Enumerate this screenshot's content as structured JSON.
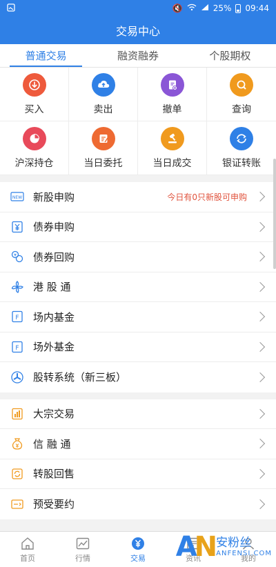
{
  "status_bar": {
    "left_icon": "image-icon",
    "battery": "25%",
    "time": "09:44"
  },
  "title": "交易中心",
  "tabs": [
    {
      "label": "普通交易",
      "active": true
    },
    {
      "label": "融资融券",
      "active": false
    },
    {
      "label": "个股期权",
      "active": false
    }
  ],
  "grid": [
    {
      "label": "买入",
      "icon": "download-icon",
      "color": "#ee5a3c"
    },
    {
      "label": "卖出",
      "icon": "upload-icon",
      "color": "#2f80e6"
    },
    {
      "label": "撤单",
      "icon": "cancel-doc-icon",
      "color": "#8a56d6"
    },
    {
      "label": "查询",
      "icon": "search-icon",
      "color": "#f09a1e"
    },
    {
      "label": "沪深持仓",
      "icon": "pie-chart-icon",
      "color": "#e84a5a"
    },
    {
      "label": "当日委托",
      "icon": "order-doc-icon",
      "color": "#ee6a32"
    },
    {
      "label": "当日成交",
      "icon": "gavel-icon",
      "color": "#f09a1e"
    },
    {
      "label": "银证转账",
      "icon": "transfer-icon",
      "color": "#2f80e6"
    }
  ],
  "list1": [
    {
      "label": "新股申购",
      "icon": "new-icon",
      "note": "今日有0只新股可申购"
    },
    {
      "label": "债券申购",
      "icon": "bond-icon",
      "note": ""
    },
    {
      "label": "债券回购",
      "icon": "repo-icon",
      "note": ""
    },
    {
      "label": "港 股 通",
      "icon": "bauhinia-icon",
      "note": ""
    },
    {
      "label": "场内基金",
      "icon": "fund-icon",
      "note": ""
    },
    {
      "label": "场外基金",
      "icon": "fund-icon",
      "note": ""
    },
    {
      "label": "股转系统（新三板）",
      "icon": "share-transfer-icon",
      "note": ""
    }
  ],
  "list2": [
    {
      "label": "大宗交易",
      "icon": "block-trade-icon",
      "note": ""
    },
    {
      "label": "信 融 通",
      "icon": "money-bag-icon",
      "note": ""
    },
    {
      "label": "转股回售",
      "icon": "cycle-icon",
      "note": ""
    },
    {
      "label": "预受要约",
      "icon": "offer-icon",
      "note": ""
    }
  ],
  "bottom_nav": [
    {
      "label": "首页",
      "icon": "home-icon",
      "active": false
    },
    {
      "label": "行情",
      "icon": "market-icon",
      "active": false
    },
    {
      "label": "交易",
      "icon": "yen-icon",
      "active": true
    },
    {
      "label": "资讯",
      "icon": "news-icon",
      "active": false
    },
    {
      "label": "我的",
      "icon": "user-icon",
      "active": false
    }
  ],
  "watermark": {
    "logo": "AN",
    "cn": "安粉丝",
    "en": "ANFENSI.COM"
  }
}
